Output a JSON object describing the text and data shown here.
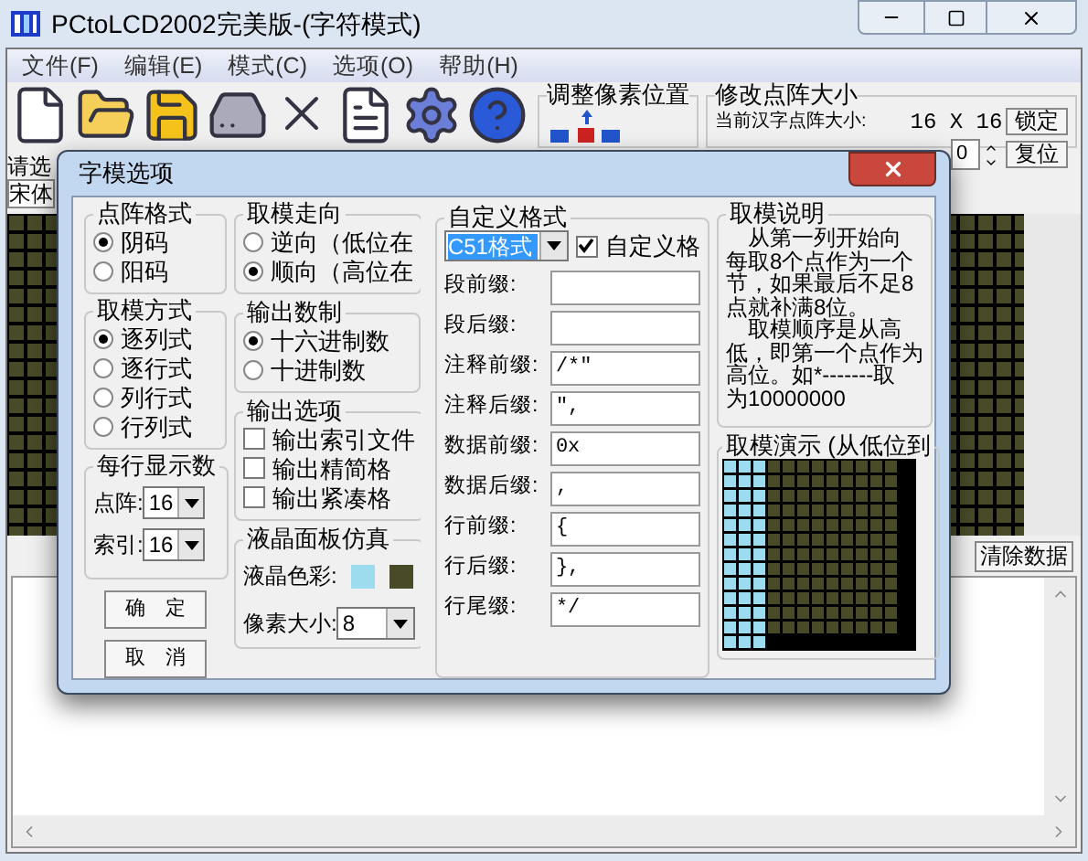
{
  "window": {
    "title": "PCtoLCD2002完美版-(字符模式)"
  },
  "menu": [
    {
      "label": "文件(F)"
    },
    {
      "label": "编辑(E)"
    },
    {
      "label": "模式(C)"
    },
    {
      "label": "选项(O)"
    },
    {
      "label": "帮助(H)"
    }
  ],
  "pixel_position": {
    "title": "调整像素位置"
  },
  "matrix_size": {
    "title": "修改点阵大小",
    "caption": "当前汉字点阵大小:",
    "value": "16 X 16",
    "lock": "锁定",
    "reset": "复位",
    "spinner": "0"
  },
  "font_panel": {
    "label": "请选",
    "font": "宋体"
  },
  "clear_button": "清除数据",
  "dialog": {
    "title": "字模选项",
    "dot_format": {
      "title": "点阵格式",
      "options": [
        {
          "label": "阴码",
          "selected": true
        },
        {
          "label": "阳码",
          "selected": false
        }
      ]
    },
    "mode": {
      "title": "取模方式",
      "options": [
        {
          "label": "逐列式",
          "selected": true
        },
        {
          "label": "逐行式",
          "selected": false
        },
        {
          "label": "列行式",
          "selected": false
        },
        {
          "label": "行列式",
          "selected": false
        }
      ]
    },
    "per_line": {
      "title": "每行显示数",
      "fields": [
        {
          "label": "点阵:",
          "value": "16"
        },
        {
          "label": "索引:",
          "value": "16"
        }
      ]
    },
    "buttons": [
      "确　定",
      "取　消"
    ],
    "direction": {
      "title": "取模走向",
      "options": [
        {
          "label": "逆向（低位在",
          "selected": false
        },
        {
          "label": "顺向（高位在",
          "selected": true
        }
      ]
    },
    "radix": {
      "title": "输出数制",
      "options": [
        {
          "label": "十六进制数",
          "selected": true
        },
        {
          "label": "十进制数",
          "selected": false
        }
      ]
    },
    "output_options": {
      "title": "输出选项",
      "options": [
        {
          "label": "输出索引文件",
          "checked": false
        },
        {
          "label": "输出精简格",
          "checked": false
        },
        {
          "label": "输出紧凑格",
          "checked": false
        }
      ]
    },
    "lcd": {
      "title": "液晶面板仿真",
      "color_label": "液晶色彩:",
      "colors": [
        {
          "color": "#9ddcee"
        },
        {
          "color": "#484a28"
        }
      ],
      "pixel_size_label": "像素大小:",
      "pixel_size": "8"
    },
    "custom": {
      "title": "自定义格式",
      "format": "C51格式",
      "checkbox": {
        "label": "自定义格",
        "checked": true
      },
      "fields": [
        {
          "label": "段前缀:"
        },
        {
          "label": "段后缀:"
        },
        {
          "label": "注释前缀:",
          "value": "/*\""
        },
        {
          "label": "注释后缀:",
          "value": "\","
        },
        {
          "label": "数据前缀:",
          "value": "0x"
        },
        {
          "label": "数据后缀:",
          "value": ","
        },
        {
          "label": "行前缀:",
          "value": "{"
        },
        {
          "label": "行后缀:",
          "value": "},"
        },
        {
          "label": "行尾缀:",
          "value": "*/"
        }
      ]
    },
    "description": {
      "title": "取模说明",
      "lines": [
        "　从第一列开始向",
        "每取8个点作为一个",
        "节，如果最后不足8",
        "点就补满8位。",
        "　取模顺序是从高",
        "低，即第一个点作为",
        "高位。如*-------取",
        "为10000000"
      ]
    },
    "demo": {
      "title": "取模演示 (从低位到"
    }
  }
}
